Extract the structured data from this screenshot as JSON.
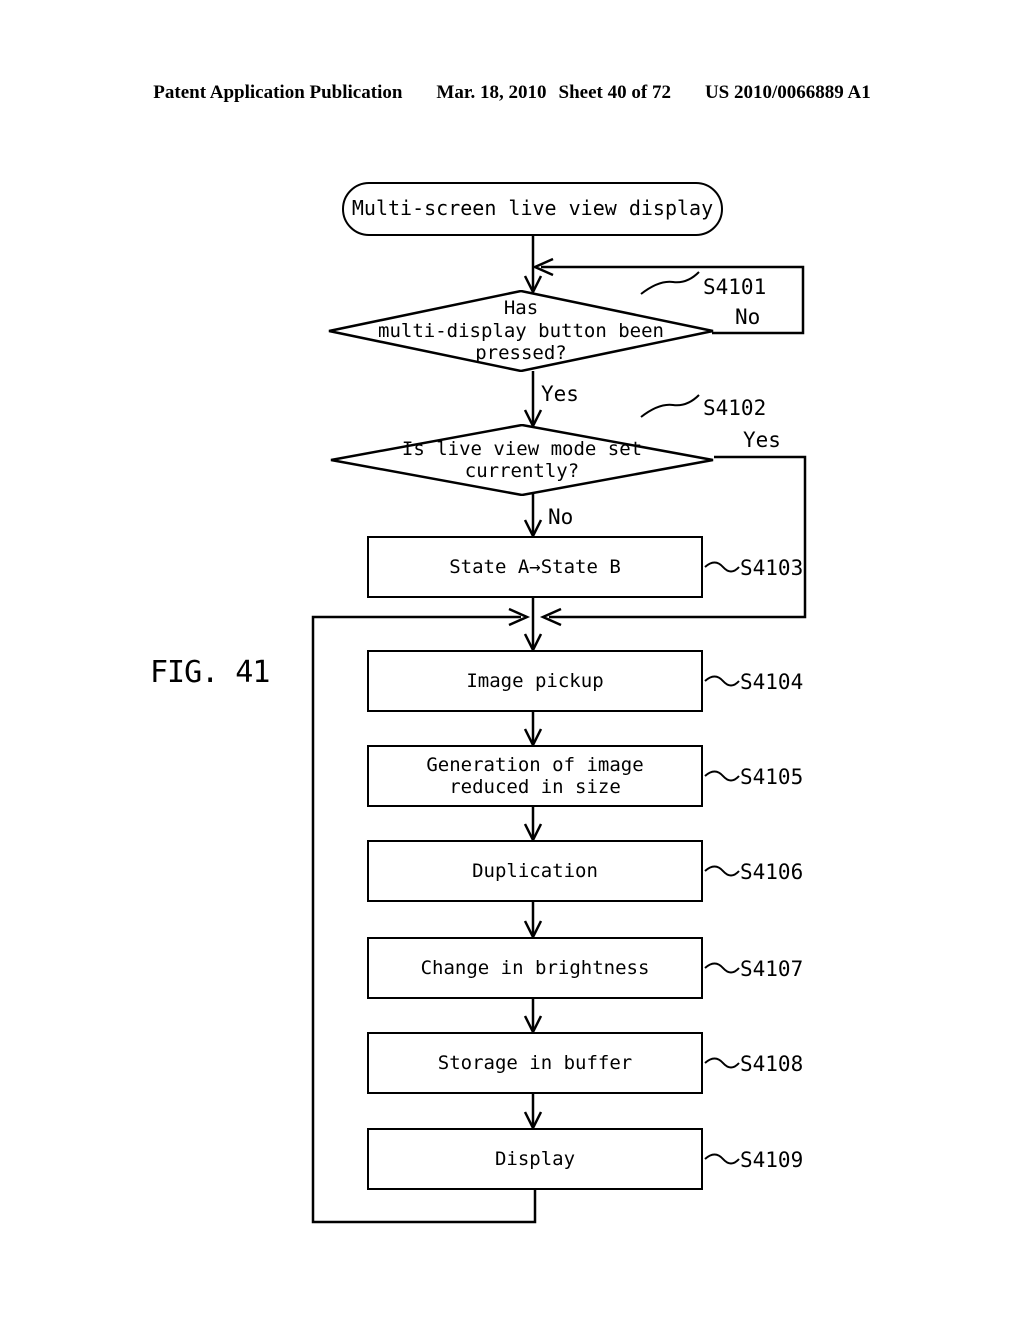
{
  "header": {
    "publication": "Patent Application Publication",
    "date": "Mar. 18, 2010",
    "sheet": "Sheet 40 of 72",
    "number": "US 2010/0066889 A1"
  },
  "figure": {
    "label": "FIG. 41"
  },
  "flowchart": {
    "start": {
      "label": "Multi-screen live view display",
      "shape": "terminator"
    },
    "decisions": [
      {
        "id": "S4101",
        "text": "Has\nmulti-display button been\npressed?",
        "yes_label": "Yes",
        "no_label": "No",
        "yes_direction": "down",
        "no_direction": "right"
      },
      {
        "id": "S4102",
        "text": "Is live view mode set\ncurrently?",
        "yes_label": "Yes",
        "no_label": "No",
        "yes_direction": "right",
        "no_direction": "down"
      }
    ],
    "steps": [
      {
        "id": "S4103",
        "text": "State A→State B"
      },
      {
        "id": "S4104",
        "text": "Image pickup"
      },
      {
        "id": "S4105",
        "text": "Generation of image\nreduced in size"
      },
      {
        "id": "S4106",
        "text": "Duplication"
      },
      {
        "id": "S4107",
        "text": "Change in brightness"
      },
      {
        "id": "S4108",
        "text": "Storage in buffer"
      },
      {
        "id": "S4109",
        "text": "Display"
      }
    ]
  },
  "colors": {
    "ink": "#000000",
    "paper": "#ffffff"
  }
}
